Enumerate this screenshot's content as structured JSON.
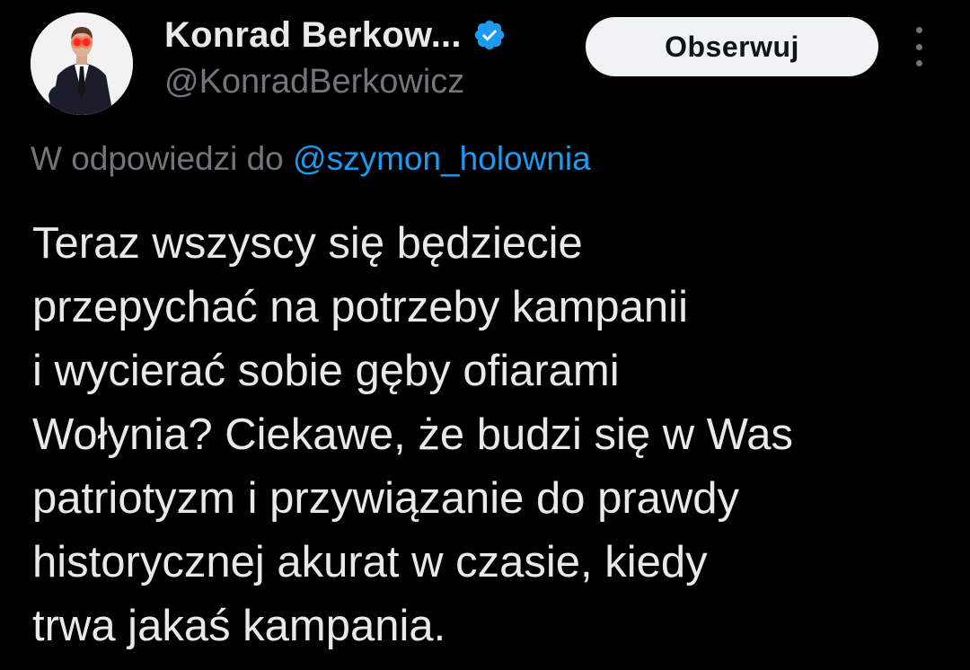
{
  "author": {
    "display_name": "Konrad Berkow...",
    "handle": "@KonradBerkowicz",
    "verified_icon": "verified-badge-icon",
    "verified_color": "#1d9bf0"
  },
  "actions": {
    "follow_label": "Obserwuj",
    "more_icon": "more-vertical-icon"
  },
  "reply_context": {
    "prefix": "W odpowiedzi do",
    "mention": "@szymon_holownia"
  },
  "tweet": {
    "lines": [
      "Teraz wszyscy się będziecie",
      "przepychać na potrzeby kampanii",
      "i wycierać sobie gęby ofiarami",
      "Wołynia? Ciekawe, że budzi się w Was",
      "patriotyzm i przywiązanie do prawdy",
      "historycznej akurat w czasie, kiedy",
      "trwa jakaś kampania."
    ]
  },
  "colors": {
    "background": "#000000",
    "primary_text": "#e7e9ea",
    "secondary_text": "#71767b",
    "link": "#1d9bf0",
    "button_bg": "#eff3f4",
    "button_text": "#0f1419"
  }
}
